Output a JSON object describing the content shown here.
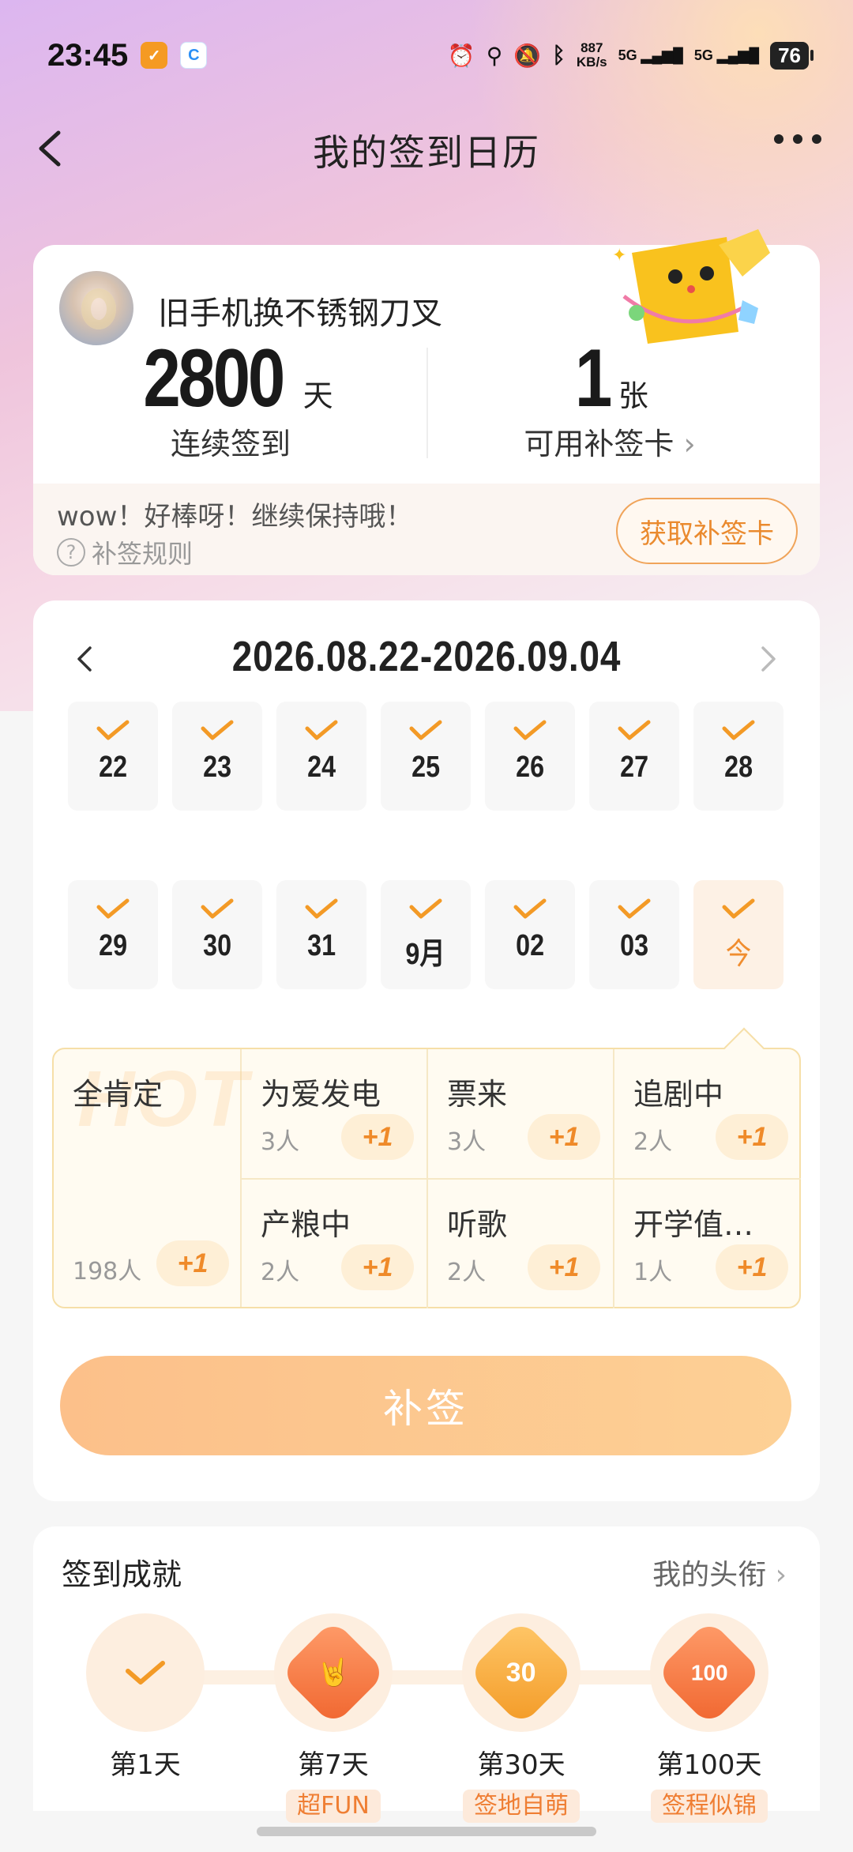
{
  "status_bar": {
    "time": "23:45",
    "network_speed_value": "887",
    "network_speed_unit": "KB/s",
    "signal1": "5G",
    "signal2": "5G",
    "battery": "76"
  },
  "nav": {
    "title": "我的签到日历"
  },
  "profile": {
    "username": "旧手机换不锈钢刀叉",
    "streak_days": "2800",
    "streak_unit": "天",
    "streak_label": "连续签到",
    "cards_count": "1",
    "cards_unit": "张",
    "cards_label": "可用补签卡",
    "encourage": "wow！好棒呀！继续保持哦！",
    "rule_label": "补签规则",
    "get_card_button": "获取补签卡"
  },
  "calendar": {
    "range": "2026.08.22-2026.09.04",
    "week1": [
      "22",
      "23",
      "24",
      "25",
      "26",
      "27",
      "28"
    ],
    "week2": [
      "29",
      "30",
      "31",
      "9月",
      "02",
      "03",
      "今"
    ]
  },
  "moods": {
    "hot_watermark": "HOT",
    "main": {
      "name": "全肯定",
      "count": "198人",
      "plus": "+1"
    },
    "items": [
      {
        "name": "为爱发电",
        "count": "3人",
        "plus": "+1"
      },
      {
        "name": "票来",
        "count": "3人",
        "plus": "+1"
      },
      {
        "name": "追剧中",
        "count": "2人",
        "plus": "+1"
      },
      {
        "name": "产粮中",
        "count": "2人",
        "plus": "+1"
      },
      {
        "name": "听歌",
        "count": "2人",
        "plus": "+1"
      },
      {
        "name": "开学值…",
        "count": "1人",
        "plus": "+1"
      }
    ]
  },
  "supplement_button": "补签",
  "achievements": {
    "title": "签到成就",
    "my_title_link": "我的头衔",
    "items": [
      {
        "day": "第1天",
        "tag": ""
      },
      {
        "day": "第7天",
        "tag": "超FUN"
      },
      {
        "day": "第30天",
        "tag": "签地自萌",
        "badge": "30"
      },
      {
        "day": "第100天",
        "tag": "签程似锦",
        "badge": "100"
      }
    ]
  },
  "colors": {
    "accent": "#ef8a29",
    "check": "#f39a26",
    "button": "#fcc08a"
  }
}
